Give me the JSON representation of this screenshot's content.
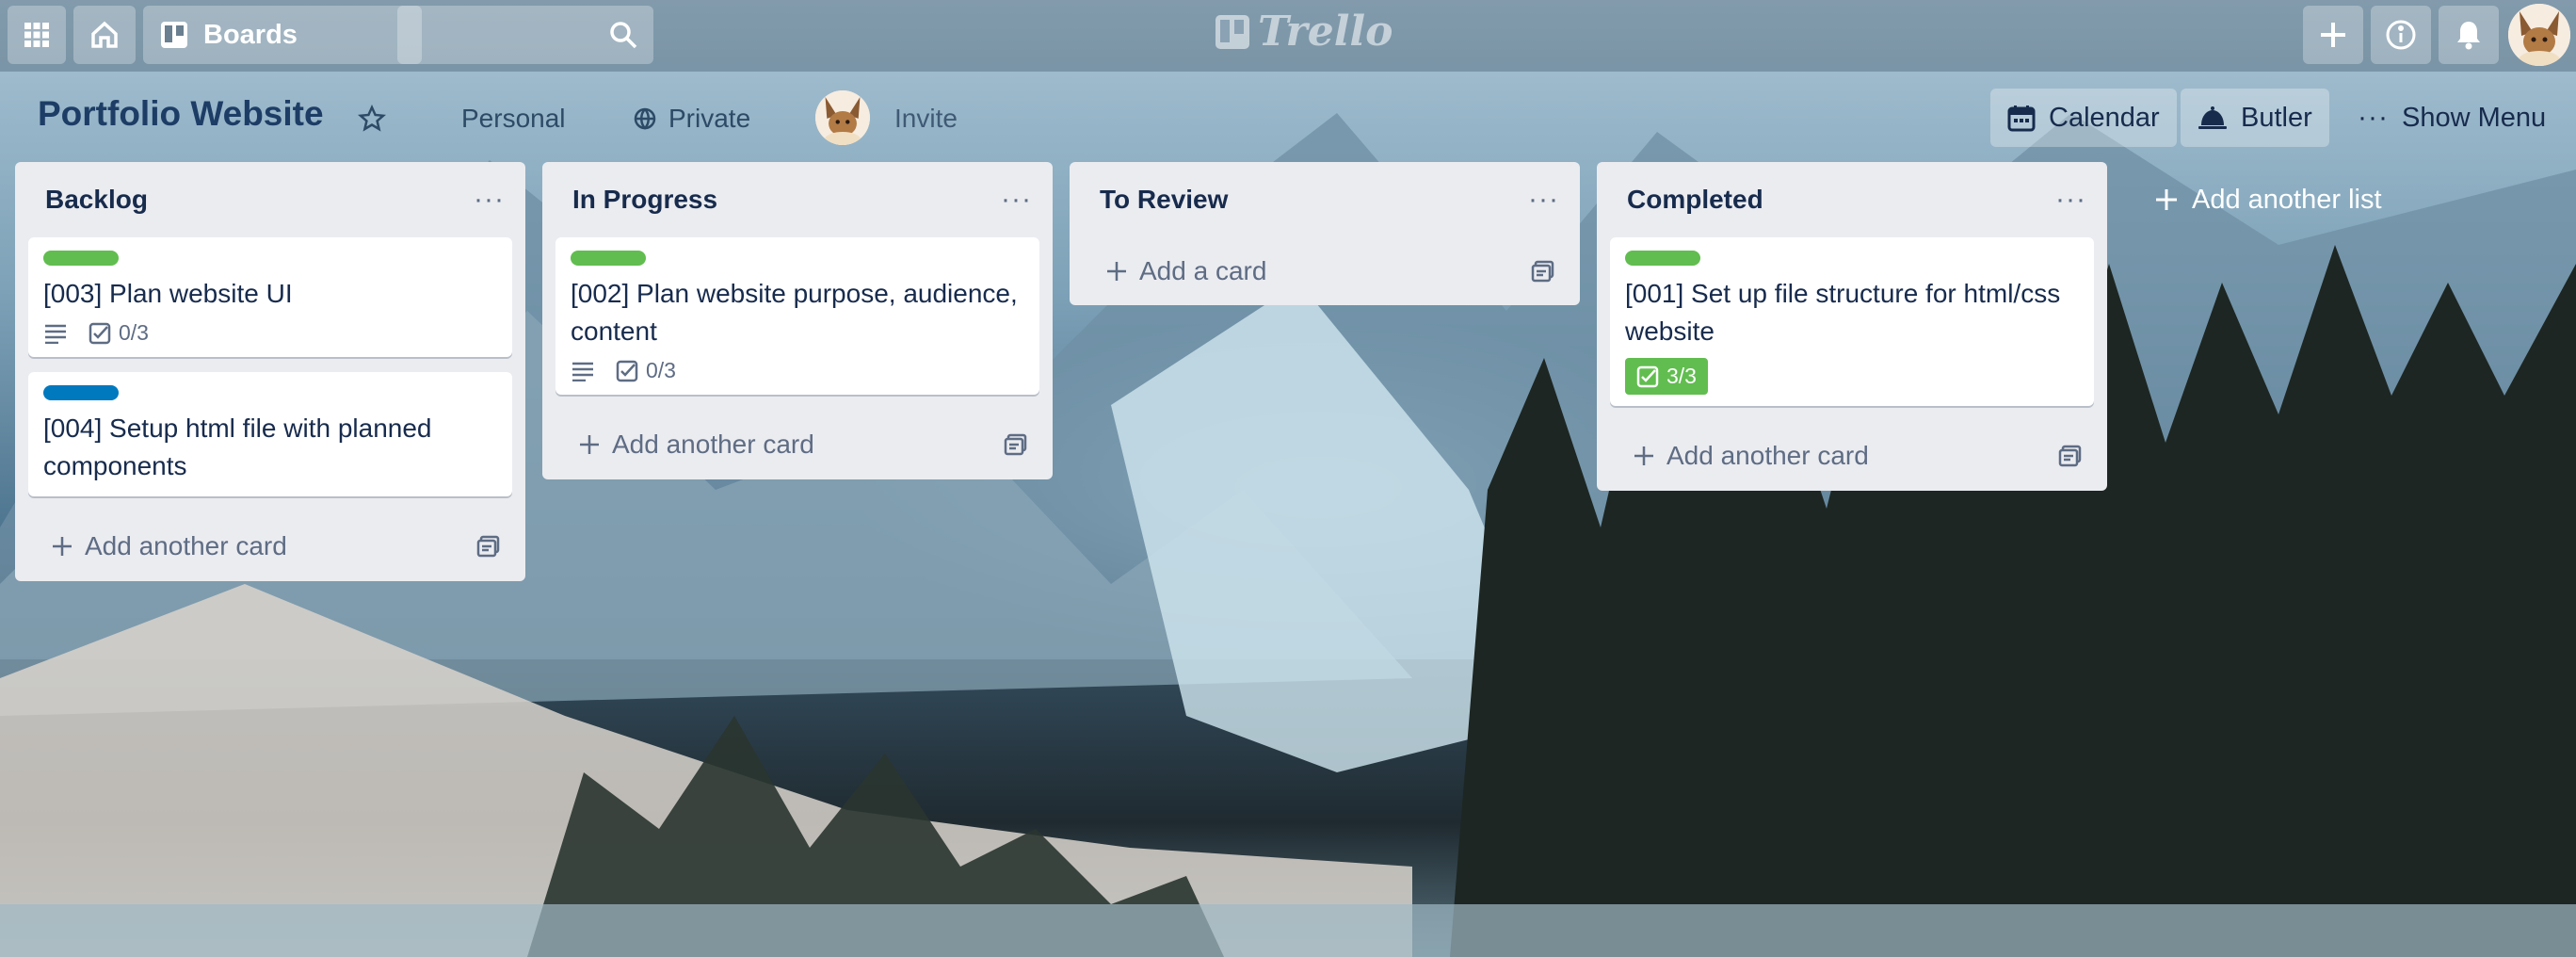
{
  "topbar": {
    "boards_label": "Boards",
    "logo_text": "Trello",
    "icons": [
      "apps-icon",
      "home-icon",
      "boards-icon",
      "search-icon",
      "plus-icon",
      "info-icon",
      "bell-icon"
    ]
  },
  "board": {
    "title": "Portfolio Website",
    "team": "Personal",
    "visibility": "Private",
    "invite_label": "Invite",
    "calendar_label": "Calendar",
    "butler_label": "Butler",
    "menu_label": "Show Menu"
  },
  "colors": {
    "label_green": "#61bd4f",
    "label_blue": "#0079bf",
    "list_bg": "#ebecf0"
  },
  "lists": [
    {
      "title": "Backlog",
      "cards": [
        {
          "title": "[003] Plan website UI",
          "label_color": "green",
          "description": true,
          "checklist": "0/3"
        },
        {
          "title": "[004] Setup html file with planned components",
          "label_color": "blue"
        }
      ],
      "add_label": "Add another card"
    },
    {
      "title": "In Progress",
      "cards": [
        {
          "title": "[002] Plan website purpose, audience, content",
          "label_color": "green",
          "description": true,
          "checklist": "0/3"
        }
      ],
      "add_label": "Add another card"
    },
    {
      "title": "To Review",
      "cards": [],
      "add_label": "Add a card"
    },
    {
      "title": "Completed",
      "cards": [
        {
          "title": "[001] Set up file structure for html/css website",
          "label_color": "green",
          "checklist": "3/3",
          "checklist_complete": true
        }
      ],
      "add_label": "Add another card"
    }
  ],
  "add_list_label": "Add another list"
}
